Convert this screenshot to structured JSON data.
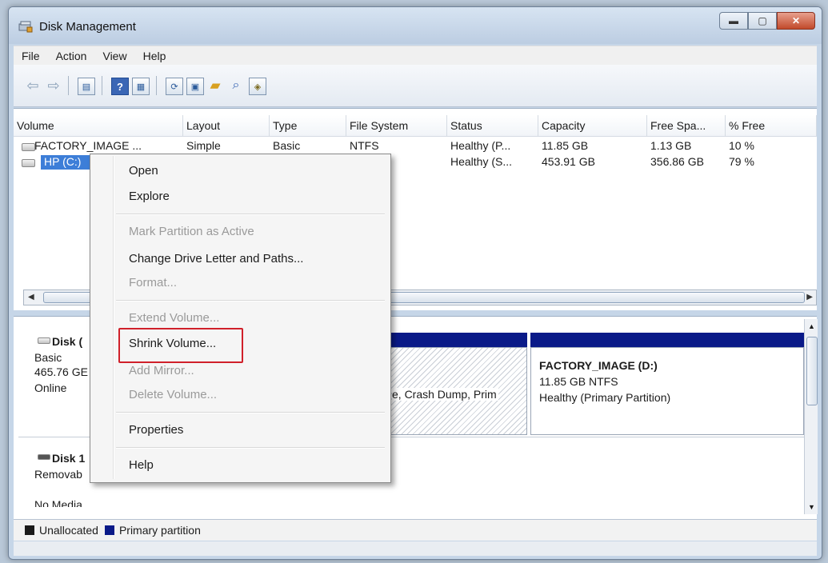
{
  "window": {
    "title": "Disk Management"
  },
  "menu": [
    "File",
    "Action",
    "View",
    "Help"
  ],
  "columns": [
    "Volume",
    "Layout",
    "Type",
    "File System",
    "Status",
    "Capacity",
    "Free Spa...",
    "% Free"
  ],
  "volumes": [
    {
      "volume": "FACTORY_IMAGE ...",
      "layout": "Simple",
      "type": "Basic",
      "fs": "NTFS",
      "status": "Healthy (P...",
      "capacity": "11.85 GB",
      "free": "1.13 GB",
      "pct": "10 %"
    },
    {
      "volume": "HP (C:)",
      "layout": "",
      "type": "",
      "fs": "",
      "status": "Healthy (S...",
      "capacity": "453.91 GB",
      "free": "356.86 GB",
      "pct": "79 %"
    }
  ],
  "disks": [
    {
      "name": "Disk (",
      "kind": "Basic",
      "size": "465.76 GE",
      "state": "Online"
    },
    {
      "name": "Disk 1",
      "kind": "Removab",
      "state": "No Media"
    }
  ],
  "partitions": {
    "hp_info": "e, Crash Dump, Prim",
    "factory_name": "FACTORY_IMAGE  (D:)",
    "factory_size": "11.85 GB NTFS",
    "factory_status": "Healthy (Primary Partition)"
  },
  "legend": {
    "unallocated": "Unallocated",
    "primary": "Primary partition",
    "unallocated_color": "#1a1a1a",
    "primary_color": "#0a1a88"
  },
  "context_menu": {
    "open": "Open",
    "explore": "Explore",
    "mark_active": "Mark Partition as Active",
    "change_letter": "Change Drive Letter and Paths...",
    "format": "Format...",
    "extend": "Extend Volume...",
    "shrink": "Shrink Volume...",
    "add_mirror": "Add Mirror...",
    "delete": "Delete Volume...",
    "properties": "Properties",
    "help": "Help"
  },
  "icons": [
    "back-icon",
    "forward-icon",
    "console-tree-icon",
    "help-icon",
    "refresh-icon",
    "properties-icon",
    "open-folder-icon",
    "search-icon",
    "rescan-icon"
  ]
}
